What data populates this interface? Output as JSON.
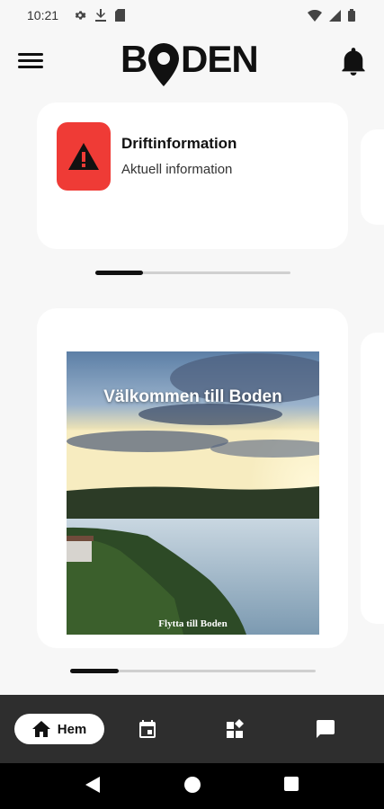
{
  "status_bar": {
    "time": "10:21",
    "left_icons": [
      "settings-icon",
      "download-icon",
      "sim-icon"
    ],
    "right_icons": [
      "wifi-icon",
      "signal-icon",
      "battery-icon"
    ]
  },
  "app_bar": {
    "menu_icon": "menu-icon",
    "logo_text": "BODEN",
    "notification_icon": "bell-icon"
  },
  "info_card": {
    "icon": "warning-icon",
    "icon_color": "#ef3b36",
    "title": "Driftinformation",
    "subtitle": "Aktuell information"
  },
  "promo_card": {
    "title": "Välkommen till Boden",
    "caption": "Flytta till Boden"
  },
  "bottom_nav": {
    "items": [
      {
        "label": "Hem",
        "icon": "home-icon",
        "active": true
      },
      {
        "label": "",
        "icon": "calendar-icon",
        "active": false
      },
      {
        "label": "",
        "icon": "widgets-icon",
        "active": false
      },
      {
        "label": "",
        "icon": "chat-icon",
        "active": false
      }
    ],
    "background": "#2e2e2e"
  },
  "system_nav": {
    "icons": [
      "back-icon",
      "home-circle-icon",
      "recents-icon"
    ]
  }
}
